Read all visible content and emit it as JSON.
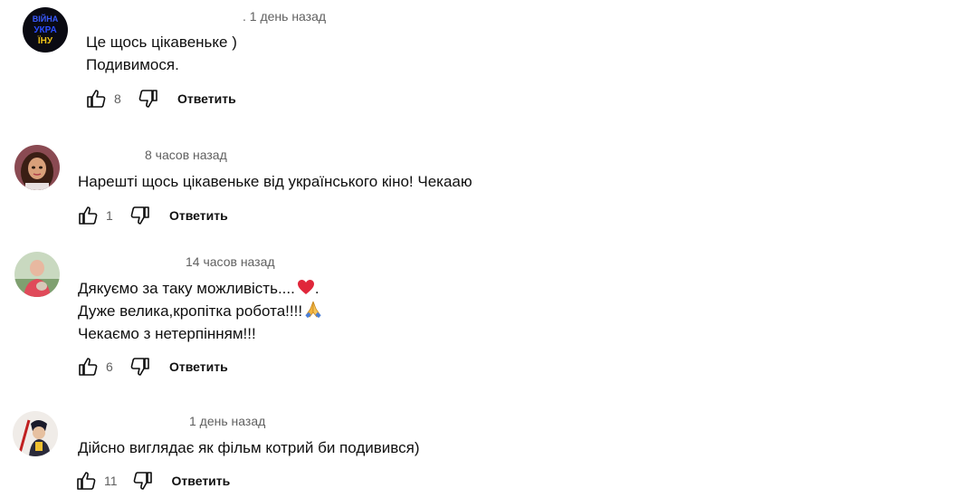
{
  "comments": [
    {
      "time": ". 1 день назад",
      "lines": [
        "Це щось цікавеньке )",
        "Подивимося."
      ],
      "likes": "8",
      "reply_label": "Ответить",
      "avatar_icon": "channel-logo-avatar"
    },
    {
      "time": "8 часов назад",
      "lines": [
        "Нарешті щось цікавеньке від українського кіно! Чекааю"
      ],
      "likes": "1",
      "reply_label": "Ответить",
      "avatar_icon": "cartoon-girl-avatar"
    },
    {
      "time": "14 часов назад",
      "lines": [
        "Дякуємо за таку можливість....",
        "Дуже велика,кропітка робота!!!!",
        "Чекаємо з нетерпінням!!!"
      ],
      "emojis": [
        "red-heart",
        "folded-hands"
      ],
      "line1_suffix": ".",
      "likes": "6",
      "reply_label": "Ответить",
      "avatar_icon": "person-photo-avatar"
    },
    {
      "time": "1 день назад",
      "lines": [
        "Дійсно виглядає як фільм котрий би подивився)"
      ],
      "likes": "11",
      "reply_label": "Ответить",
      "avatar_icon": "illustrated-character-avatar"
    }
  ],
  "icons": {
    "like": "thumb-up-icon",
    "dislike": "thumb-down-icon"
  },
  "colors": {
    "secondary_text": "#606060",
    "primary_text": "#0f0f0f"
  }
}
